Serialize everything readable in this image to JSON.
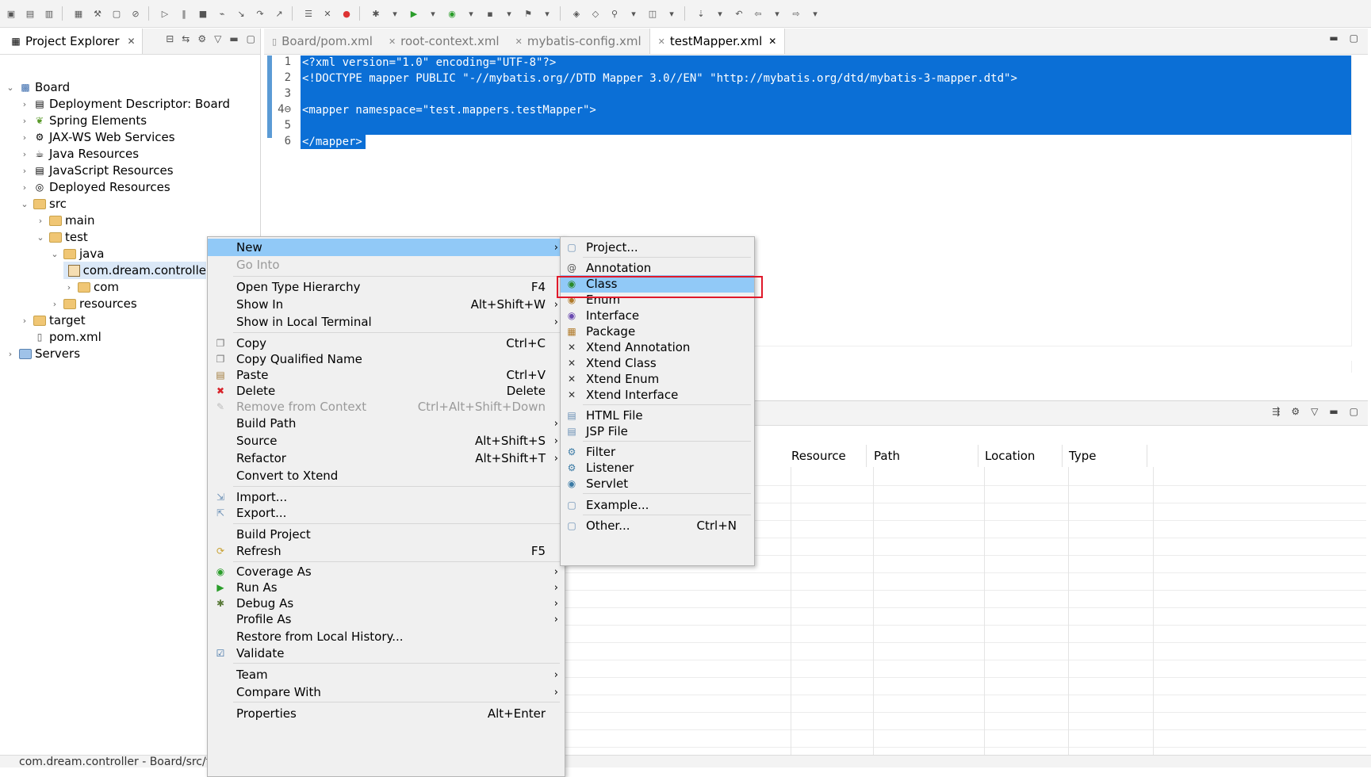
{
  "project_explorer": {
    "tab_title": "Project Explorer",
    "tree": [
      {
        "label": "Board",
        "icon": "project-icon"
      },
      {
        "label": "Deployment Descriptor: Board",
        "icon": "deployment-descriptor-icon"
      },
      {
        "label": "Spring Elements",
        "icon": "spring-icon"
      },
      {
        "label": "JAX-WS Web Services",
        "icon": "webservice-icon"
      },
      {
        "label": "Java Resources",
        "icon": "java-resources-icon"
      },
      {
        "label": "JavaScript Resources",
        "icon": "javascript-resources-icon"
      },
      {
        "label": "Deployed Resources",
        "icon": "deployed-resources-icon"
      },
      {
        "label": "src",
        "icon": "folder-icon"
      },
      {
        "label": "main",
        "icon": "folder-icon"
      },
      {
        "label": "test",
        "icon": "folder-icon"
      },
      {
        "label": "java",
        "icon": "folder-icon"
      },
      {
        "label": "com.dream.controlle",
        "icon": "package-icon"
      },
      {
        "label": "com",
        "icon": "folder-icon"
      },
      {
        "label": "resources",
        "icon": "folder-icon"
      },
      {
        "label": "target",
        "icon": "folder-icon"
      },
      {
        "label": "pom.xml",
        "icon": "xml-file-icon"
      },
      {
        "label": "Servers",
        "icon": "folder-icon"
      }
    ]
  },
  "editor": {
    "tabs": [
      {
        "label": "Board/pom.xml",
        "active": false
      },
      {
        "label": "root-context.xml",
        "active": false
      },
      {
        "label": "mybatis-config.xml",
        "active": false
      },
      {
        "label": "testMapper.xml",
        "active": true
      }
    ],
    "lines": [
      {
        "num": "1",
        "text": "<?xml version=\"1.0\" encoding=\"UTF-8\"?>"
      },
      {
        "num": "2",
        "text": "<!DOCTYPE mapper PUBLIC \"-//mybatis.org//DTD Mapper 3.0//EN\" \"http://mybatis.org/dtd/mybatis-3-mapper.dtd\">"
      },
      {
        "num": "3",
        "text": ""
      },
      {
        "num": "4⊖",
        "text": "<mapper namespace=\"test.mappers.testMapper\">"
      },
      {
        "num": "5",
        "text": ""
      },
      {
        "num": "6",
        "text": "</mapper>"
      }
    ],
    "selection_color": "#0b6fd6"
  },
  "bottom_view": {
    "columns": [
      "Resource",
      "Path",
      "Location",
      "Type"
    ]
  },
  "status_bar": {
    "text": "com.dream.controller - Board/src/te"
  },
  "context_menu": {
    "items": [
      {
        "label": "New",
        "shortcut": "",
        "arrow": "›",
        "icon": "",
        "disabled": false,
        "highlighted": true
      },
      {
        "label": "Go Into",
        "shortcut": "",
        "arrow": "",
        "icon": "",
        "disabled": true
      },
      {
        "label": "Open Type Hierarchy",
        "shortcut": "F4",
        "arrow": "",
        "icon": ""
      },
      {
        "label": "Show In",
        "shortcut": "Alt+Shift+W",
        "arrow": "›",
        "icon": ""
      },
      {
        "label": "Show in Local Terminal",
        "shortcut": "",
        "arrow": "›",
        "icon": ""
      },
      {
        "label": "Copy",
        "shortcut": "Ctrl+C",
        "arrow": "",
        "icon": "copy-icon"
      },
      {
        "label": "Copy Qualified Name",
        "shortcut": "",
        "arrow": "",
        "icon": "copy-qualified-name-icon"
      },
      {
        "label": "Paste",
        "shortcut": "Ctrl+V",
        "arrow": "",
        "icon": "paste-icon"
      },
      {
        "label": "Delete",
        "shortcut": "Delete",
        "arrow": "",
        "icon": "delete-icon"
      },
      {
        "label": "Remove from Context",
        "shortcut": "Ctrl+Alt+Shift+Down",
        "arrow": "",
        "icon": "remove-context-icon",
        "disabled": true
      },
      {
        "label": "Build Path",
        "shortcut": "",
        "arrow": "›",
        "icon": ""
      },
      {
        "label": "Source",
        "shortcut": "Alt+Shift+S",
        "arrow": "›",
        "icon": ""
      },
      {
        "label": "Refactor",
        "shortcut": "Alt+Shift+T",
        "arrow": "›",
        "icon": ""
      },
      {
        "label": "Convert to Xtend",
        "shortcut": "",
        "arrow": "",
        "icon": ""
      },
      {
        "label": "Import...",
        "shortcut": "",
        "arrow": "",
        "icon": "import-icon"
      },
      {
        "label": "Export...",
        "shortcut": "",
        "arrow": "",
        "icon": "export-icon"
      },
      {
        "label": "Build Project",
        "shortcut": "",
        "arrow": "",
        "icon": ""
      },
      {
        "label": "Refresh",
        "shortcut": "F5",
        "arrow": "",
        "icon": "refresh-icon"
      },
      {
        "label": "Coverage As",
        "shortcut": "",
        "arrow": "›",
        "icon": "coverage-icon"
      },
      {
        "label": "Run As",
        "shortcut": "",
        "arrow": "›",
        "icon": "run-icon"
      },
      {
        "label": "Debug As",
        "shortcut": "",
        "arrow": "›",
        "icon": "debug-icon"
      },
      {
        "label": "Profile As",
        "shortcut": "",
        "arrow": "›",
        "icon": ""
      },
      {
        "label": "Restore from Local History...",
        "shortcut": "",
        "arrow": "",
        "icon": ""
      },
      {
        "label": "Validate",
        "shortcut": "",
        "arrow": "",
        "icon": "validate-check-icon"
      },
      {
        "label": "Team",
        "shortcut": "",
        "arrow": "›",
        "icon": ""
      },
      {
        "label": "Compare With",
        "shortcut": "",
        "arrow": "›",
        "icon": ""
      },
      {
        "label": "Properties",
        "shortcut": "Alt+Enter",
        "arrow": "",
        "icon": ""
      }
    ]
  },
  "new_submenu": {
    "items": [
      {
        "label": "Project...",
        "shortcut": "",
        "icon": "project-wizard-icon"
      },
      {
        "label": "Annotation",
        "shortcut": "",
        "icon": "annotation-icon"
      },
      {
        "label": "Class",
        "shortcut": "",
        "icon": "class-icon",
        "highlighted": true
      },
      {
        "label": "Enum",
        "shortcut": "",
        "icon": "enum-icon"
      },
      {
        "label": "Interface",
        "shortcut": "",
        "icon": "interface-icon"
      },
      {
        "label": "Package",
        "shortcut": "",
        "icon": "package-icon"
      },
      {
        "label": "Xtend Annotation",
        "shortcut": "",
        "icon": "xtend-icon"
      },
      {
        "label": "Xtend Class",
        "shortcut": "",
        "icon": "xtend-icon"
      },
      {
        "label": "Xtend Enum",
        "shortcut": "",
        "icon": "xtend-icon"
      },
      {
        "label": "Xtend Interface",
        "shortcut": "",
        "icon": "xtend-icon"
      },
      {
        "label": "HTML File",
        "shortcut": "",
        "icon": "html-file-icon"
      },
      {
        "label": "JSP File",
        "shortcut": "",
        "icon": "jsp-file-icon"
      },
      {
        "label": "Filter",
        "shortcut": "",
        "icon": "filter-icon"
      },
      {
        "label": "Listener",
        "shortcut": "",
        "icon": "listener-icon"
      },
      {
        "label": "Servlet",
        "shortcut": "",
        "icon": "servlet-icon"
      },
      {
        "label": "Example...",
        "shortcut": "",
        "icon": "example-icon"
      },
      {
        "label": "Other...",
        "shortcut": "Ctrl+N",
        "icon": "other-wizard-icon"
      }
    ]
  },
  "colors": {
    "menu_highlight": "#91c9f7",
    "callout_red": "#e0192a"
  }
}
